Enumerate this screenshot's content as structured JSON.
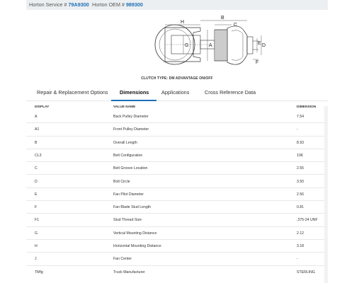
{
  "header": {
    "service_label": "Horton Service #",
    "service_number": "79A9300",
    "oem_label": "Horton OEM #",
    "oem_number": "989300"
  },
  "diagram": {
    "caption": "CLUTCH TYPE: DM ADVANTAGE ON/OFF",
    "labels": {
      "H": "H",
      "C": "C",
      "B": "B",
      "A": "A",
      "G": "G",
      "E": "E",
      "D": "D",
      "F": "F"
    }
  },
  "tabs": [
    {
      "label": "Repair & Replacement Options",
      "active": false
    },
    {
      "label": "Dimensions",
      "active": true
    },
    {
      "label": "Applications",
      "active": false
    },
    {
      "label": "Cross Reference Data",
      "active": false
    }
  ],
  "table": {
    "headers": [
      "DISPLAY",
      "VALUE NAME",
      "DIMENSION"
    ],
    "rows": [
      [
        "A",
        "Back Pulley Diameter",
        "7.54"
      ],
      [
        "A1",
        "Front Pulley Diameter",
        "-"
      ],
      [
        "B",
        "Overall Length",
        "8.93"
      ],
      [
        "CL3",
        "Belt Configuration",
        "10K"
      ],
      [
        "C",
        "Belt Groove Location",
        "2.55"
      ],
      [
        "D",
        "Bolt Circle",
        "3.50"
      ],
      [
        "E",
        "Fan Pilot Diameter",
        "2.56"
      ],
      [
        "F",
        "Fan Blade Stud Length",
        "0.81"
      ],
      [
        "F1",
        "Stud Thread Size",
        ".375-24 UNF"
      ],
      [
        "G",
        "Vertical Mounting Distance",
        "2.12"
      ],
      [
        "H",
        "Horizontal Mounting Distance",
        "3.18"
      ],
      [
        "J",
        "Fan Center",
        "-"
      ],
      [
        "TMfg",
        "Truck Manufacturer",
        "STERLING"
      ]
    ]
  },
  "colors": {
    "accent": "#1d6fb8",
    "header_bg": "#eceff1"
  }
}
